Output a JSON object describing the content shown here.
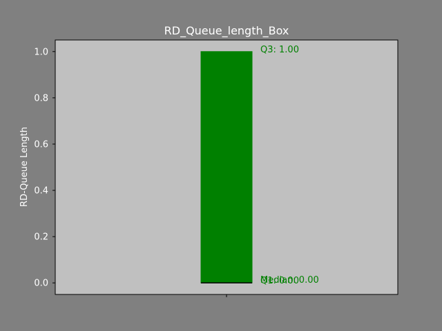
{
  "chart_data": {
    "type": "box",
    "title": "RD_Queue_length_Box",
    "xlabel": "",
    "ylabel": "RD-Queue Length",
    "ylim": [
      -0.05,
      1.05
    ],
    "yticks": [
      "0.0",
      "0.2",
      "0.4",
      "0.6",
      "0.8",
      "1.0"
    ],
    "ytick_values": [
      0.0,
      0.2,
      0.4,
      0.6,
      0.8,
      1.0
    ],
    "xticks": [
      ""
    ],
    "grid": false,
    "box": {
      "q1": 0.0,
      "median": 0.0,
      "q3": 1.0
    },
    "annotations": {
      "q3": "Q3: 1.00",
      "median": "Median: 0.00",
      "q1": "Q1: 0.00"
    }
  },
  "colors": {
    "figure_background": "#808080",
    "axes_background": "#c0c0c0",
    "box_fill": "#008000",
    "annotation": "#008000",
    "text": "#ffffff",
    "median_line": "#000000"
  }
}
